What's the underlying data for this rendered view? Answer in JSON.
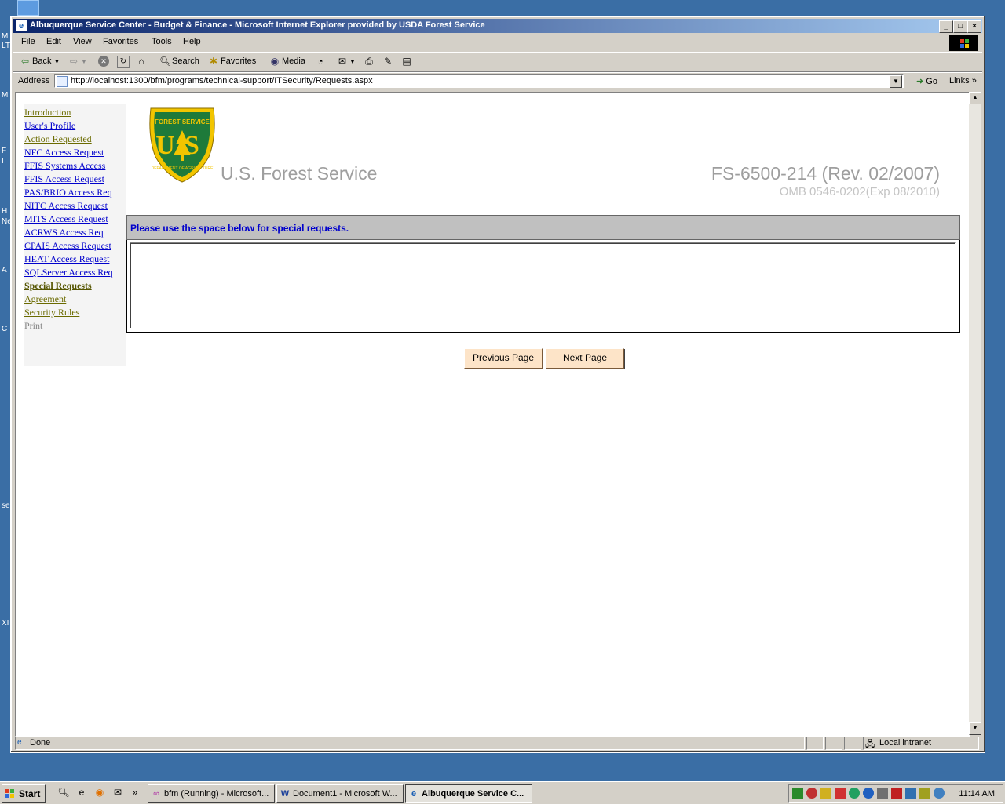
{
  "desktop": {
    "fragments": [
      "M",
      "LT",
      "M",
      "F",
      "I",
      "H",
      "Ne",
      "A",
      "C",
      "se",
      "XI"
    ]
  },
  "window": {
    "title": "Albuquerque Service Center - Budget & Finance - Microsoft Internet Explorer provided by USDA Forest Service",
    "controls": {
      "minimize": "_",
      "maximize": "□",
      "close": "×"
    }
  },
  "menu": [
    "File",
    "Edit",
    "View",
    "Favorites",
    "Tools",
    "Help"
  ],
  "toolbar": {
    "back": "Back",
    "search": "Search",
    "favorites": "Favorites",
    "media": "Media"
  },
  "address": {
    "label": "Address",
    "url": "http://localhost:1300/bfm/programs/technical-support/ITSecurity/Requests.aspx",
    "go": "Go",
    "links": "Links"
  },
  "nav": [
    {
      "label": "Introduction",
      "state": "visited"
    },
    {
      "label": "User's Profile",
      "state": "unvisited"
    },
    {
      "label": "Action Requested",
      "state": "visited"
    },
    {
      "label": "NFC Access Request",
      "state": "unvisited"
    },
    {
      "label": "FFIS Systems Access",
      "state": "unvisited"
    },
    {
      "label": "FFIS Access Request",
      "state": "unvisited"
    },
    {
      "label": "PAS/BRIO Access Req",
      "state": "unvisited"
    },
    {
      "label": "NITC Access Request",
      "state": "unvisited"
    },
    {
      "label": "MITS Access Request",
      "state": "unvisited"
    },
    {
      "label": "ACRWS Access Req",
      "state": "unvisited"
    },
    {
      "label": "CPAIS Access Request",
      "state": "unvisited"
    },
    {
      "label": "HEAT Access Request",
      "state": "unvisited"
    },
    {
      "label": "SQLServer Access Req",
      "state": "unvisited"
    },
    {
      "label": "Special Requests",
      "state": "current"
    },
    {
      "label": "Agreement",
      "state": "visited"
    },
    {
      "label": "Security Rules",
      "state": "visited"
    },
    {
      "label": "Print",
      "state": "disabled"
    }
  ],
  "header": {
    "agency": "U.S. Forest Service",
    "form_number": "FS-6500-214 (Rev. 02/2007)",
    "omb": "OMB 0546-0202(Exp 08/2010)",
    "shield_text_top": "FOREST SERVICE",
    "shield_text_mid": "US",
    "shield_text_bottom": "DEPARTMENT OF AGRICULTURE"
  },
  "form": {
    "instruction": "Please use the space below for special requests.",
    "special_requests_value": ""
  },
  "buttons": {
    "previous": "Previous Page",
    "next": "Next Page"
  },
  "status": {
    "text": "Done",
    "zone": "Local intranet"
  },
  "taskbar": {
    "start": "Start",
    "tasks": [
      {
        "label": "bfm (Running) - Microsoft...",
        "active": false
      },
      {
        "label": "Document1 - Microsoft W...",
        "active": false
      },
      {
        "label": "Albuquerque Service C...",
        "active": true
      }
    ],
    "clock": "11:14 AM"
  },
  "colors": {
    "desktop": "#3a6ea5",
    "title_start": "#0a246a",
    "link": "#0000cc",
    "visited_link": "#6b6b00",
    "button_face": "#fde4c8",
    "panel_header": "#c0c0c0",
    "shield_green": "#1e7a3a",
    "shield_gold": "#f2c500"
  }
}
